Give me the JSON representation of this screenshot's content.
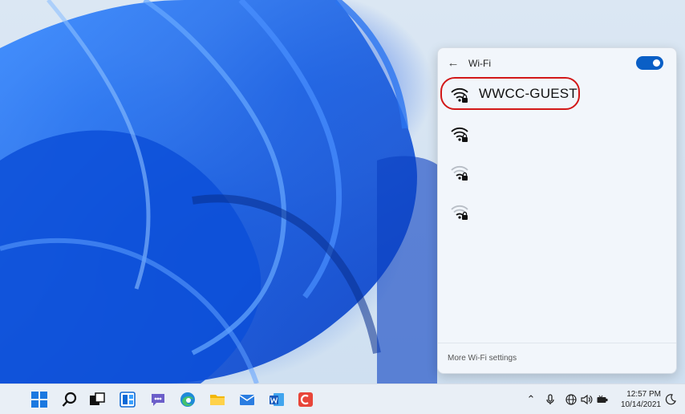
{
  "flyout": {
    "title": "Wi-Fi",
    "toggle_state": "on",
    "networks": [
      {
        "name": "WWCC-GUEST",
        "secured": true,
        "highlighted": true
      },
      {
        "name": "",
        "secured": true
      },
      {
        "name": "",
        "secured": true
      },
      {
        "name": "",
        "secured": true
      }
    ],
    "footer_link": "More Wi-Fi settings"
  },
  "taskbar": {
    "apps": [
      "windows-start-icon",
      "search-icon",
      "task-view-icon",
      "widgets-icon",
      "teams-chat-icon",
      "edge-icon",
      "file-explorer-icon",
      "mail-icon",
      "word-icon",
      "app-icon"
    ],
    "tray": [
      "chevron-up-icon",
      "microphone-icon",
      "network-globe-icon",
      "volume-icon",
      "battery-icon",
      "focus-moon-icon"
    ],
    "time": "12:57 PM",
    "date": "10/14/2021"
  },
  "colors": {
    "accent": "#0a5fc6",
    "highlight_ring": "#d21818"
  }
}
